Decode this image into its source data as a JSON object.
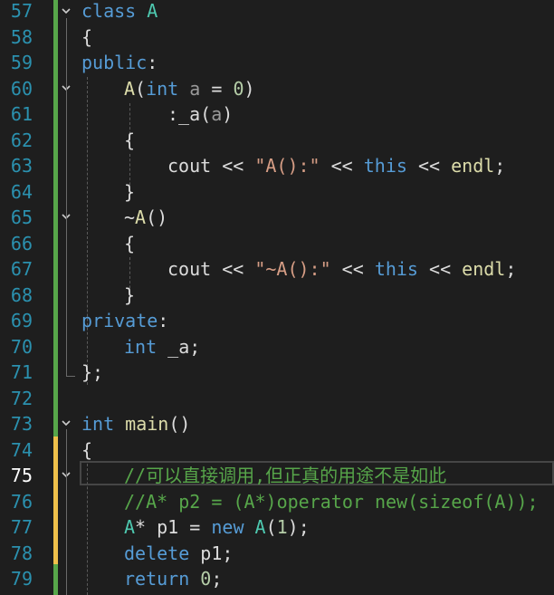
{
  "editor": {
    "line_numbers": [
      "57",
      "58",
      "59",
      "60",
      "61",
      "62",
      "63",
      "64",
      "65",
      "66",
      "67",
      "68",
      "69",
      "70",
      "71",
      "72",
      "73",
      "74",
      "75",
      "76",
      "77",
      "78",
      "79"
    ],
    "current_line": "75",
    "colors": {
      "background": "#1e1e1e",
      "line_number": "#2b91af",
      "keyword": "#569cd6",
      "type": "#4ec9b0",
      "function": "#dcdcaa",
      "string": "#d69d85",
      "comment": "#57a64a",
      "saved_change_bar": "#57a64a",
      "unsaved_change_bar": "#efc04b"
    },
    "fold_icon": "chevron-down-icon",
    "code": {
      "l57": [
        "class",
        " ",
        "A"
      ],
      "l58": [
        "{"
      ],
      "l59": [
        "public",
        ":"
      ],
      "l60": [
        "A",
        "(",
        "int",
        " ",
        "a",
        " = ",
        "0",
        ")"
      ],
      "l61": [
        ":",
        "_a",
        "(",
        "a",
        ")"
      ],
      "l62": [
        "{"
      ],
      "l63": [
        "cout",
        " << ",
        "\"A():\"",
        " << ",
        "this",
        " << ",
        "endl",
        ";"
      ],
      "l64": [
        "}"
      ],
      "l65": [
        "~",
        "A",
        "()"
      ],
      "l66": [
        "{"
      ],
      "l67": [
        "cout",
        " << ",
        "\"~A():\"",
        " << ",
        "this",
        " << ",
        "endl",
        ";"
      ],
      "l68": [
        "}"
      ],
      "l69": [
        "private",
        ":"
      ],
      "l70": [
        "int",
        " ",
        "_a",
        ";"
      ],
      "l71": [
        "};"
      ],
      "l72": [
        ""
      ],
      "l73": [
        "int",
        " ",
        "main",
        "()"
      ],
      "l74": [
        "{"
      ],
      "l75": [
        "//可以直接调用,但正真的用途不是如此"
      ],
      "l76": [
        "//A* p2 = (A*)operator new(sizeof(A));"
      ],
      "l77": [
        "A",
        "* ",
        "p1",
        " = ",
        "new",
        " ",
        "A",
        "(",
        "1",
        ");"
      ],
      "l78": [
        "delete",
        " ",
        "p1",
        ";"
      ],
      "l79": [
        "return",
        " ",
        "0",
        ";"
      ]
    }
  }
}
